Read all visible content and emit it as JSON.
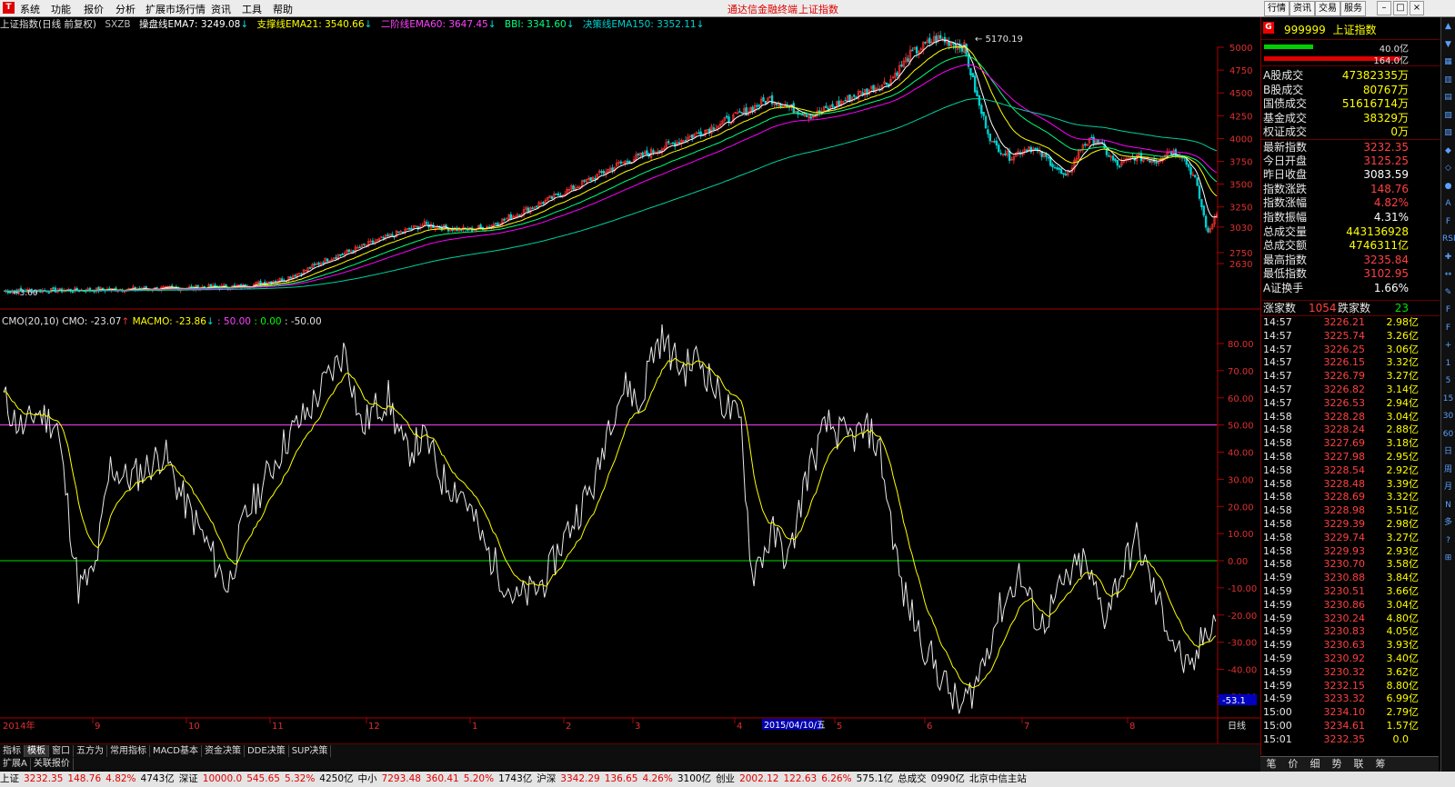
{
  "menu": {
    "items": [
      "系统",
      "功能",
      "报价",
      "分析",
      "扩展市场行情",
      "资讯",
      "工具",
      "帮助"
    ],
    "center_links": [
      "通达信金融终端",
      "上证指数"
    ],
    "right_buttons": [
      "行情",
      "资讯",
      "交易",
      "服务"
    ],
    "window_buttons": [
      "–",
      "□",
      "×"
    ]
  },
  "info": {
    "title": "上证指数(日线 前复权)",
    "code": "SXZB",
    "ma1": "操盘线EMA7: 3249.08",
    "ma2": "支撑线EMA21: 3540.66",
    "ma3": "二阶线EMA60: 3647.45",
    "ma4": "BBI: 3341.60",
    "ma5": "决策线EMA150: 3352.11",
    "arrow_down": "↓"
  },
  "price_chart": {
    "y_ticks": [
      "5000",
      "4750",
      "4500",
      "4250",
      "4000",
      "3750",
      "3500",
      "3250",
      "3030",
      "2750",
      "2630"
    ],
    "high_label": "5170.19",
    "low_label": "3.60",
    "colors": {
      "up": "#ff3030",
      "down": "#00d0d0",
      "ema7": "#ffffff",
      "ema21": "#ffff00",
      "ema60": "#ff00ff",
      "ema150": "#00d0a0"
    }
  },
  "indicator": {
    "header_name": "CMO(20,10)",
    "cmo_label": "CMO: -23.07",
    "macmo_label": "MACMO: -23.86",
    "line50": ": 50.00",
    "line0": ": 0.00",
    "linem50": ": -50.00",
    "y_ticks": [
      "80.00",
      "70.00",
      "60.00",
      "50.00",
      "40.00",
      "30.00",
      "20.00",
      "10.00",
      "0.00",
      "-10.00",
      "-20.00",
      "-30.00",
      "-40.00",
      "-50.00"
    ],
    "current_value": "-53.1"
  },
  "dates": {
    "year": "2014年",
    "months": [
      "9",
      "10",
      "11",
      "12",
      "1",
      "2",
      "3",
      "4",
      "5",
      "6",
      "7",
      "8"
    ],
    "cursor_date": "2015/04/10/五",
    "period": "日线"
  },
  "quote": {
    "code": "999999",
    "name": "上证指数",
    "bar1_value": "40.0亿",
    "bar2_value": "164.0亿",
    "rows": [
      {
        "label": "A股成交",
        "value": "47382335万",
        "color": "#ffff00"
      },
      {
        "label": "B股成交",
        "value": "80767万",
        "color": "#ffff00"
      },
      {
        "label": "国债成交",
        "value": "51616714万",
        "color": "#ffff00"
      },
      {
        "label": "基金成交",
        "value": "38329万",
        "color": "#ffff00"
      },
      {
        "label": "权证成交",
        "value": "0万",
        "color": "#ffff00"
      },
      {
        "label": "最新指数",
        "value": "3232.35",
        "color": "#ff4040"
      },
      {
        "label": "今日开盘",
        "value": "3125.25",
        "color": "#ff4040"
      },
      {
        "label": "昨日收盘",
        "value": "3083.59",
        "color": "#ffffff"
      },
      {
        "label": "指数涨跌",
        "value": "148.76",
        "color": "#ff4040"
      },
      {
        "label": "指数涨幅",
        "value": "4.82%",
        "color": "#ff4040"
      },
      {
        "label": "指数振幅",
        "value": "4.31%",
        "color": "#ffffff"
      },
      {
        "label": "总成交量",
        "value": "443136928",
        "color": "#ffff00"
      },
      {
        "label": "总成交额",
        "value": "4746311亿",
        "color": "#ffff00"
      },
      {
        "label": "最高指数",
        "value": "3235.84",
        "color": "#ff4040"
      },
      {
        "label": "最低指数",
        "value": "3102.95",
        "color": "#ff4040"
      },
      {
        "label": "A证换手",
        "value": "1.66%",
        "color": "#ffffff"
      }
    ],
    "up_label": "涨家数",
    "up_count": "1054",
    "down_label": "跌家数",
    "down_count": "23"
  },
  "ticks": [
    {
      "t": "14:57",
      "p": "3226.21",
      "a": "2.98",
      "u": "亿"
    },
    {
      "t": "14:57",
      "p": "3225.74",
      "a": "3.26",
      "u": "亿"
    },
    {
      "t": "14:57",
      "p": "3226.25",
      "a": "3.06",
      "u": "亿"
    },
    {
      "t": "14:57",
      "p": "3226.15",
      "a": "3.32",
      "u": "亿"
    },
    {
      "t": "14:57",
      "p": "3226.79",
      "a": "3.27",
      "u": "亿"
    },
    {
      "t": "14:57",
      "p": "3226.82",
      "a": "3.14",
      "u": "亿"
    },
    {
      "t": "14:57",
      "p": "3226.53",
      "a": "2.94",
      "u": "亿"
    },
    {
      "t": "14:58",
      "p": "3228.28",
      "a": "3.04",
      "u": "亿"
    },
    {
      "t": "14:58",
      "p": "3228.24",
      "a": "2.88",
      "u": "亿"
    },
    {
      "t": "14:58",
      "p": "3227.69",
      "a": "3.18",
      "u": "亿"
    },
    {
      "t": "14:58",
      "p": "3227.98",
      "a": "2.95",
      "u": "亿"
    },
    {
      "t": "14:58",
      "p": "3228.54",
      "a": "2.92",
      "u": "亿"
    },
    {
      "t": "14:58",
      "p": "3228.48",
      "a": "3.39",
      "u": "亿"
    },
    {
      "t": "14:58",
      "p": "3228.69",
      "a": "3.32",
      "u": "亿"
    },
    {
      "t": "14:58",
      "p": "3228.98",
      "a": "3.51",
      "u": "亿"
    },
    {
      "t": "14:58",
      "p": "3229.39",
      "a": "2.98",
      "u": "亿"
    },
    {
      "t": "14:58",
      "p": "3229.74",
      "a": "3.27",
      "u": "亿"
    },
    {
      "t": "14:58",
      "p": "3229.93",
      "a": "2.93",
      "u": "亿"
    },
    {
      "t": "14:58",
      "p": "3230.70",
      "a": "3.58",
      "u": "亿"
    },
    {
      "t": "14:59",
      "p": "3230.88",
      "a": "3.84",
      "u": "亿"
    },
    {
      "t": "14:59",
      "p": "3230.51",
      "a": "3.66",
      "u": "亿"
    },
    {
      "t": "14:59",
      "p": "3230.86",
      "a": "3.04",
      "u": "亿"
    },
    {
      "t": "14:59",
      "p": "3230.24",
      "a": "4.80",
      "u": "亿"
    },
    {
      "t": "14:59",
      "p": "3230.83",
      "a": "4.05",
      "u": "亿"
    },
    {
      "t": "14:59",
      "p": "3230.63",
      "a": "3.93",
      "u": "亿"
    },
    {
      "t": "14:59",
      "p": "3230.92",
      "a": "3.40",
      "u": "亿"
    },
    {
      "t": "14:59",
      "p": "3230.32",
      "a": "3.62",
      "u": "亿"
    },
    {
      "t": "14:59",
      "p": "3232.15",
      "a": "8.80",
      "u": "亿"
    },
    {
      "t": "14:59",
      "p": "3233.32",
      "a": "6.99",
      "u": "亿"
    },
    {
      "t": "15:00",
      "p": "3234.10",
      "a": "2.79",
      "u": "亿"
    },
    {
      "t": "15:00",
      "p": "3234.61",
      "a": "1.57",
      "u": "亿"
    },
    {
      "t": "15:01",
      "p": "3232.35",
      "a": "0.0",
      "u": ""
    }
  ],
  "right_tabs": [
    "笔",
    "价",
    "细",
    "势",
    "联",
    "筹"
  ],
  "side_icons": [
    "▲",
    "▼",
    "▦",
    "▥",
    "▤",
    "▧",
    "▨",
    "◆",
    "◇",
    "●",
    "A",
    "F",
    "RSI",
    "✚",
    "↔",
    "✎",
    "F",
    "F",
    "+",
    "1",
    "5",
    "15",
    "30",
    "60",
    "日",
    "周",
    "月",
    "N",
    "多",
    "?",
    "⊞"
  ],
  "bottom_tabs": [
    "指标",
    "模板",
    "窗口",
    "五方为",
    "常用指标",
    "MACD基本",
    "资金决策",
    "DDE决策",
    "SUP决策"
  ],
  "bottom_tabs_active": 1,
  "sub_tabs": [
    "扩展A",
    "关联报价"
  ],
  "status": [
    {
      "text": "上证",
      "color": "#000"
    },
    {
      "text": "3232.35",
      "color": "#e00000"
    },
    {
      "text": "148.76",
      "color": "#e00000"
    },
    {
      "text": "4.82%",
      "color": "#e00000"
    },
    {
      "text": "4743亿",
      "color": "#000"
    },
    {
      "text": "深证",
      "color": "#000"
    },
    {
      "text": "10000.0",
      "color": "#e00000"
    },
    {
      "text": "545.65",
      "color": "#e00000"
    },
    {
      "text": "5.32%",
      "color": "#e00000"
    },
    {
      "text": "4250亿",
      "color": "#000"
    },
    {
      "text": "中小",
      "color": "#000"
    },
    {
      "text": "7293.48",
      "color": "#e00000"
    },
    {
      "text": "360.41",
      "color": "#e00000"
    },
    {
      "text": "5.20%",
      "color": "#e00000"
    },
    {
      "text": "1743亿",
      "color": "#000"
    },
    {
      "text": "沪深",
      "color": "#000"
    },
    {
      "text": "3342.29",
      "color": "#e00000"
    },
    {
      "text": "136.65",
      "color": "#e00000"
    },
    {
      "text": "4.26%",
      "color": "#e00000"
    },
    {
      "text": "3100亿",
      "color": "#000"
    },
    {
      "text": "创业",
      "color": "#000"
    },
    {
      "text": "2002.12",
      "color": "#e00000"
    },
    {
      "text": "122.63",
      "color": "#e00000"
    },
    {
      "text": "6.26%",
      "color": "#e00000"
    },
    {
      "text": "575.1亿",
      "color": "#000"
    },
    {
      "text": "总成交",
      "color": "#000"
    },
    {
      "text": "0990亿",
      "color": "#000"
    },
    {
      "text": "北京中信主站",
      "color": "#000"
    }
  ]
}
